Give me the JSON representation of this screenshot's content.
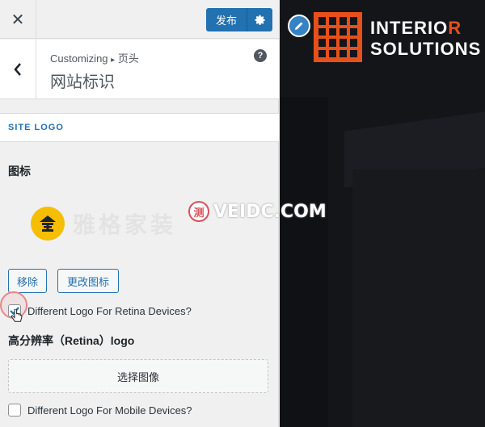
{
  "topbar": {
    "close_glyph": "✕",
    "publish_label": "发布",
    "gear_icon": "gear-icon"
  },
  "section": {
    "breadcrumb_root": "Customizing",
    "breadcrumb_sep": "▸",
    "breadcrumb_leaf": "页头",
    "title": "网站标识",
    "help_glyph": "?"
  },
  "site_logo": {
    "heading": "SITE LOGO",
    "control_label": "图标",
    "logo_text": "雅格家装",
    "remove_label": "移除",
    "change_label": "更改图标"
  },
  "retina": {
    "checkbox_label": "Different Logo For Retina Devices?",
    "checked": true,
    "logo_label": "高分辨率（Retina）logo",
    "select_image_label": "选择图像"
  },
  "mobile": {
    "checkbox_label": "Different Logo For Mobile Devices?",
    "checked": false
  },
  "preview": {
    "brand_line1_main": "INTERIO",
    "brand_line1_accent": "R",
    "brand_line2": "SOLUTIONS",
    "brand_color": "#e8501b"
  },
  "watermark": {
    "badge": "测",
    "text": "VEIDC.COM"
  },
  "colors": {
    "accent": "#2271b1",
    "preview_bg": "#141519"
  }
}
